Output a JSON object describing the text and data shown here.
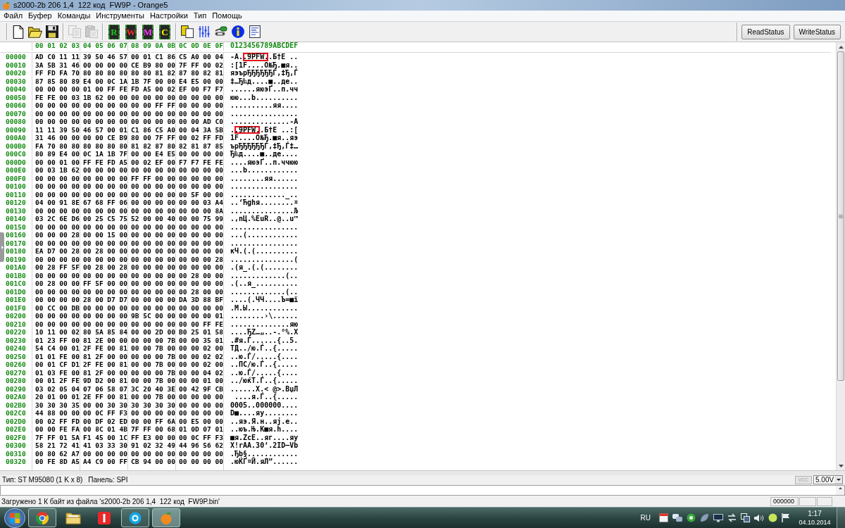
{
  "window": {
    "title": "s2000-2b 206 1,4  122 код  FW9P - Orange5"
  },
  "menu": [
    "Файл",
    "Буфер",
    "Команды",
    "Инструменты",
    "Настройки",
    "Тип",
    "Помощь"
  ],
  "toolbar": {
    "buttons": [
      {
        "disabled": false
      },
      {
        "disabled": false
      },
      {
        "disabled": false
      },
      {
        "disabled": true
      },
      {
        "disabled": true
      }
    ],
    "chips": [
      "R",
      "W",
      "M",
      "C"
    ],
    "status_buttons": [
      "ReadStatus",
      "WriteStatus"
    ]
  },
  "hex_view": {
    "column_header": [
      "00 01 02 03",
      "04 05 06 07",
      "08 09 0A 0B",
      "0C 0D 0E 0F"
    ],
    "ascii_header": "0123456789ABCDEF",
    "rows": [
      {
        "address": "00000",
        "bytes": [
          "AD C0 11 11",
          "39 50 46 57",
          "00 01 C1 86",
          "C5 A0 00 04"
        ],
        "ascii": [
          {
            "text": "-А.",
            "boxed": false
          },
          {
            "text": ".9PFW.",
            "boxed": true
          },
          {
            "text": ".Б†Е ..",
            "boxed": false
          }
        ]
      },
      {
        "address": "00010",
        "bytes": [
          "3A 5B 31 46",
          "00 00 00 00",
          "CE B9 80 00",
          "7F FF 00 02"
        ],
        "ascii": [
          {
            "text": ":[1F....О№Ђ.■я..",
            "boxed": false
          }
        ]
      },
      {
        "address": "00020",
        "bytes": [
          "FF FD FA 70",
          "80 80 80 80",
          "80 80 81 82",
          "87 80 82 81"
        ],
        "ascii": [
          {
            "text": "яэърЂЂЂЂЂЂЃ‚‡Ђ‚Ѓ",
            "boxed": false
          }
        ]
      },
      {
        "address": "00030",
        "bytes": [
          "87 85 80 89",
          "E4 00 0C 1A",
          "1B 7F 00 00",
          "E4 E5 00 00"
        ],
        "ascii": [
          {
            "text": "‡…Ђ‰д....■..де..",
            "boxed": false
          }
        ]
      },
      {
        "address": "00040",
        "bytes": [
          "00 00 00 00",
          "01 00 FF FE",
          "FD A5 00 02",
          "EF 00 F7 F7"
        ],
        "ascii": [
          {
            "text": "......яюэҐ..п.чч",
            "boxed": false
          }
        ]
      },
      {
        "address": "00050",
        "bytes": [
          "FE FE 00 03",
          "1B 62 00 00",
          "00 00 00 00",
          "00 00 00 00"
        ],
        "ascii": [
          {
            "text": "юю...b..........",
            "boxed": false
          }
        ]
      },
      {
        "address": "00060",
        "bytes": [
          "00 00 00 00",
          "00 00 00 00",
          "00 00 FF FF",
          "00 00 00 00"
        ],
        "ascii": [
          {
            "text": "..........яя....",
            "boxed": false
          }
        ]
      },
      {
        "address": "00070",
        "bytes": [
          "00 00 00 00",
          "00 00 00 00",
          "00 00 00 00",
          "00 00 00 00"
        ],
        "ascii": [
          {
            "text": "................",
            "boxed": false
          }
        ]
      },
      {
        "address": "00080",
        "bytes": [
          "00 00 00 00",
          "00 00 00 00",
          "00 00 00 00",
          "00 00 AD C0"
        ],
        "ascii": [
          {
            "text": "..............-А",
            "boxed": false
          }
        ]
      },
      {
        "address": "00090",
        "bytes": [
          "11 11 39 50",
          "46 57 00 01",
          "C1 86 C5 A0",
          "00 04 3A 5B"
        ],
        "ascii": [
          {
            "text": ".",
            "boxed": false
          },
          {
            "text": ".9PFW.",
            "boxed": true
          },
          {
            "text": ".Б†Е ..:[",
            "boxed": false
          }
        ]
      },
      {
        "address": "000A0",
        "bytes": [
          "31 46 00 00",
          "00 00 CE B9",
          "80 00 7F FF",
          "00 02 FF FD"
        ],
        "ascii": [
          {
            "text": "1F....О№Ђ.■я..яэ",
            "boxed": false
          }
        ]
      },
      {
        "address": "000B0",
        "bytes": [
          "FA 70 80 80",
          "80 80 80 80",
          "81 82 87 80",
          "82 81 87 85"
        ],
        "ascii": [
          {
            "text": "ърЂЂЂЂЂЂЃ‚‡Ђ‚Ѓ‡…",
            "boxed": false
          }
        ]
      },
      {
        "address": "000C0",
        "bytes": [
          "80 89 E4 00",
          "0C 1A 1B 7F",
          "00 00 E4 E5",
          "00 00 00 00"
        ],
        "ascii": [
          {
            "text": "Ђ‰д....■..де....",
            "boxed": false
          }
        ]
      },
      {
        "address": "000D0",
        "bytes": [
          "00 00 01 00",
          "FF FE FD A5",
          "00 02 EF 00",
          "F7 F7 FE FE"
        ],
        "ascii": [
          {
            "text": "....яюэҐ..п.ччюю",
            "boxed": false
          }
        ]
      },
      {
        "address": "000E0",
        "bytes": [
          "00 03 1B 62",
          "00 00 00 00",
          "00 00 00 00",
          "00 00 00 00"
        ],
        "ascii": [
          {
            "text": "...b............",
            "boxed": false
          }
        ]
      },
      {
        "address": "000F0",
        "bytes": [
          "00 00 00 00",
          "00 00 00 00",
          "FF FF 00 00",
          "00 00 00 00"
        ],
        "ascii": [
          {
            "text": "........яя......",
            "boxed": false
          }
        ]
      },
      {
        "address": "00100",
        "bytes": [
          "00 00 00 00",
          "00 00 00 00",
          "00 00 00 00",
          "00 00 00 00"
        ],
        "ascii": [
          {
            "text": "................",
            "boxed": false
          }
        ]
      },
      {
        "address": "00110",
        "bytes": [
          "00 00 00 00",
          "00 00 00 00",
          "00 00 00 00",
          "00 5F 00 00"
        ],
        "ascii": [
          {
            "text": "............._..",
            "boxed": false
          }
        ]
      },
      {
        "address": "00120",
        "bytes": [
          "04 00 91 8E",
          "67 68 FF 06",
          "00 00 00 00",
          "00 00 03 A4"
        ],
        "ascii": [
          {
            "text": "..‘Ћghя........¤",
            "boxed": false
          }
        ]
      },
      {
        "address": "00130",
        "bytes": [
          "00 00 00 00",
          "00 00 00 00",
          "00 00 00 00",
          "00 00 00 8A"
        ],
        "ascii": [
          {
            "text": "...............Љ",
            "boxed": false
          }
        ]
      },
      {
        "address": "00140",
        "bytes": [
          "03 2C 6E D6",
          "00 25 C5 75",
          "52 00 00 40",
          "00 00 75 99"
        ],
        "ascii": [
          {
            "text": ".,nЦ.%ЕuR..@..u™",
            "boxed": false
          }
        ]
      },
      {
        "address": "00150",
        "bytes": [
          "00 00 00 00",
          "00 00 00 00",
          "00 00 00 00",
          "00 00 00 00"
        ],
        "ascii": [
          {
            "text": "................",
            "boxed": false
          }
        ]
      },
      {
        "address": "00160",
        "bytes": [
          "00 00 00 28",
          "00 00 15 00",
          "00 00 00 00",
          "00 00 00 00"
        ],
        "ascii": [
          {
            "text": "...(............",
            "boxed": false
          }
        ]
      },
      {
        "address": "00170",
        "bytes": [
          "00 00 00 00",
          "00 00 00 00",
          "00 00 00 00",
          "00 00 00 00"
        ],
        "ascii": [
          {
            "text": "................",
            "boxed": false
          }
        ]
      },
      {
        "address": "00180",
        "bytes": [
          "EA D7 00 28",
          "00 28 00 00",
          "00 00 00 00",
          "00 00 00 00"
        ],
        "ascii": [
          {
            "text": "кЧ.(.(..........",
            "boxed": false
          }
        ]
      },
      {
        "address": "00190",
        "bytes": [
          "00 00 00 00",
          "00 00 00 00",
          "00 00 00 00",
          "00 00 00 28"
        ],
        "ascii": [
          {
            "text": "...............(",
            "boxed": false
          }
        ]
      },
      {
        "address": "001A0",
        "bytes": [
          "00 28 FF 5F",
          "00 28 00 28",
          "00 00 00 00",
          "00 00 00 00"
        ],
        "ascii": [
          {
            "text": ".(я_.(.(........",
            "boxed": false
          }
        ]
      },
      {
        "address": "001B0",
        "bytes": [
          "00 00 00 00",
          "00 00 00 00",
          "00 00 00 00",
          "00 28 00 00"
        ],
        "ascii": [
          {
            "text": ".............(..",
            "boxed": false
          }
        ]
      },
      {
        "address": "001C0",
        "bytes": [
          "00 28 00 00",
          "FF 5F 00 00",
          "00 00 00 00",
          "00 00 00 00"
        ],
        "ascii": [
          {
            "text": ".(..я_..........",
            "boxed": false
          }
        ]
      },
      {
        "address": "001D0",
        "bytes": [
          "00 00 00 00",
          "00 00 00 00",
          "00 00 00 00",
          "00 28 00 00"
        ],
        "ascii": [
          {
            "text": ".............(..",
            "boxed": false
          }
        ]
      },
      {
        "address": "001E0",
        "bytes": [
          "00 00 00 00",
          "28 00 D7 D7",
          "00 00 00 00",
          "DA 3D 88 BF"
        ],
        "ascii": [
          {
            "text": "....(.ЧЧ....Ъ=■ї",
            "boxed": false
          }
        ]
      },
      {
        "address": "001F0",
        "bytes": [
          "00 CC 00 DB",
          "00 00 00 00",
          "00 00 00 00",
          "00 00 00 00"
        ],
        "ascii": [
          {
            "text": ".М.Ы............",
            "boxed": false
          }
        ]
      },
      {
        "address": "00200",
        "bytes": [
          "00 00 00 00",
          "00 00 00 00",
          "9B 5C 00 00",
          "00 00 00 01"
        ],
        "ascii": [
          {
            "text": "........›\\......",
            "boxed": false
          }
        ]
      },
      {
        "address": "00210",
        "bytes": [
          "00 00 00 00",
          "00 00 00 00",
          "00 00 00 00",
          "00 00 FF FE"
        ],
        "ascii": [
          {
            "text": "..............яю",
            "boxed": false
          }
        ]
      },
      {
        "address": "00220",
        "bytes": [
          "10 11 00 02",
          "80 5A 85 84",
          "00 00 2D 00",
          "B0 25 01 58"
        ],
        "ascii": [
          {
            "text": "....ЂZ…„..-.°%.X",
            "boxed": false
          }
        ]
      },
      {
        "address": "00230",
        "bytes": [
          "01 23 FF 00",
          "81 2E 00 00",
          "00 00 00 7B",
          "00 00 35 01"
        ],
        "ascii": [
          {
            "text": ".#я.Ѓ......{..5.",
            "boxed": false
          }
        ]
      },
      {
        "address": "00240",
        "bytes": [
          "54 C4 00 01",
          "2F FE 00 81",
          "00 00 7B 00",
          "00 00 02 00"
        ],
        "ascii": [
          {
            "text": "TД../ю.Ѓ..{.....",
            "boxed": false
          }
        ]
      },
      {
        "address": "00250",
        "bytes": [
          "01 01 FE 00",
          "81 2F 00 00",
          "00 00 00 7B",
          "00 00 02 02"
        ],
        "ascii": [
          {
            "text": "..ю.Ѓ/.....{....",
            "boxed": false
          }
        ]
      },
      {
        "address": "00260",
        "bytes": [
          "00 01 CF D1",
          "2F FE 00 81",
          "00 00 7B 00",
          "00 00 02 00"
        ],
        "ascii": [
          {
            "text": "..ПС/ю.Ѓ..{.....",
            "boxed": false
          }
        ]
      },
      {
        "address": "00270",
        "bytes": [
          "01 03 FE 00",
          "81 2F 00 00",
          "00 00 00 7B",
          "00 00 04 02"
        ],
        "ascii": [
          {
            "text": "..ю.Ѓ/.....{....",
            "boxed": false
          }
        ]
      },
      {
        "address": "00280",
        "bytes": [
          "00 01 2F FE",
          "9D D2 00 81",
          "00 00 7B 00",
          "00 00 01 00"
        ],
        "ascii": [
          {
            "text": "../юќТ.Ѓ..{.....",
            "boxed": false
          }
        ]
      },
      {
        "address": "00290",
        "bytes": [
          "03 02 05 04",
          "07 06 58 07",
          "3C 20 40 3E",
          "00 42 9F CB"
        ],
        "ascii": [
          {
            "text": "......X.< @>.BџЛ",
            "boxed": false
          }
        ]
      },
      {
        "address": "002A0",
        "bytes": [
          "20 01 00 01",
          "2E FF 00 81",
          "00 00 7B 00",
          "00 00 00 00"
        ],
        "ascii": [
          {
            "text": " ....я.Ѓ..{.....",
            "boxed": false
          }
        ]
      },
      {
        "address": "002B0",
        "bytes": [
          "30 30 30 35",
          "00 00 30 30",
          "30 30 30 30",
          "00 00 00 00"
        ],
        "ascii": [
          {
            "text": "0005..000000....",
            "boxed": false
          }
        ]
      },
      {
        "address": "002C0",
        "bytes": [
          "44 88 00 00",
          "00 0C FF F3",
          "00 00 00 00",
          "00 00 00 00"
        ],
        "ascii": [
          {
            "text": "D■....яу........",
            "boxed": false
          }
        ]
      },
      {
        "address": "002D0",
        "bytes": [
          "00 02 FF FD",
          "00 DF 02 ED",
          "00 00 FF 6A",
          "00 E5 00 00"
        ],
        "ascii": [
          {
            "text": "..яэ.Я.н..яj.е..",
            "boxed": false
          }
        ]
      },
      {
        "address": "002E0",
        "bytes": [
          "00 00 FE FA",
          "00 8C 01 4B",
          "7F FF 00 68",
          "01 0D 07 01"
        ],
        "ascii": [
          {
            "text": "..юъ.Њ.K■я.h....",
            "boxed": false
          }
        ]
      },
      {
        "address": "002F0",
        "bytes": [
          "7F FF 01 5A",
          "F1 45 00 1C",
          "FF E3 00 00",
          "00 0C FF F3"
        ],
        "ascii": [
          {
            "text": "■я.ZсE..яг....яу",
            "boxed": false
          }
        ]
      },
      {
        "address": "00300",
        "bytes": [
          "58 21 72 41",
          "41 03 33 30",
          "91 02 32 49",
          "44 96 56 62"
        ],
        "ascii": [
          {
            "text": "X!rAA.30‘.2ID–Vb",
            "boxed": false
          }
        ]
      },
      {
        "address": "00310",
        "bytes": [
          "00 80 62 A7",
          "00 00 00 00",
          "00 00 00 00",
          "00 00 00 00"
        ],
        "ascii": [
          {
            "text": ".Ђb§............",
            "boxed": false
          }
        ]
      },
      {
        "address": "00320",
        "bytes": [
          "00 FE 8D A5",
          "A4 C9 00 FF",
          "CB 94 00 00",
          "00 00 00 00"
        ],
        "ascii": [
          {
            "text": ".юЌҐ¤Й.яЛ”......",
            "boxed": false
          }
        ]
      }
    ]
  },
  "info_bar": {
    "chip_type": "Тип: ST M95080 (1 K x 8)",
    "panel": "Панель: SPI",
    "vcc_button": {
      "label": "VCC",
      "disabled": true
    },
    "voltage": "5.00V"
  },
  "status_bar": {
    "message": "Загружено 1 К байт из файла 's2000-2b 206 1,4  122 код  FW9P.bin'",
    "address": "000000"
  },
  "taskbar": {
    "apps": [
      {
        "running": true,
        "selected": false
      },
      {
        "running": false,
        "selected": false
      },
      {
        "running": false,
        "selected": false
      },
      {
        "running": true,
        "selected": false
      },
      {
        "running": true,
        "selected": true
      }
    ],
    "language": "RU",
    "time": "1:17",
    "date": "04.10.2014"
  }
}
